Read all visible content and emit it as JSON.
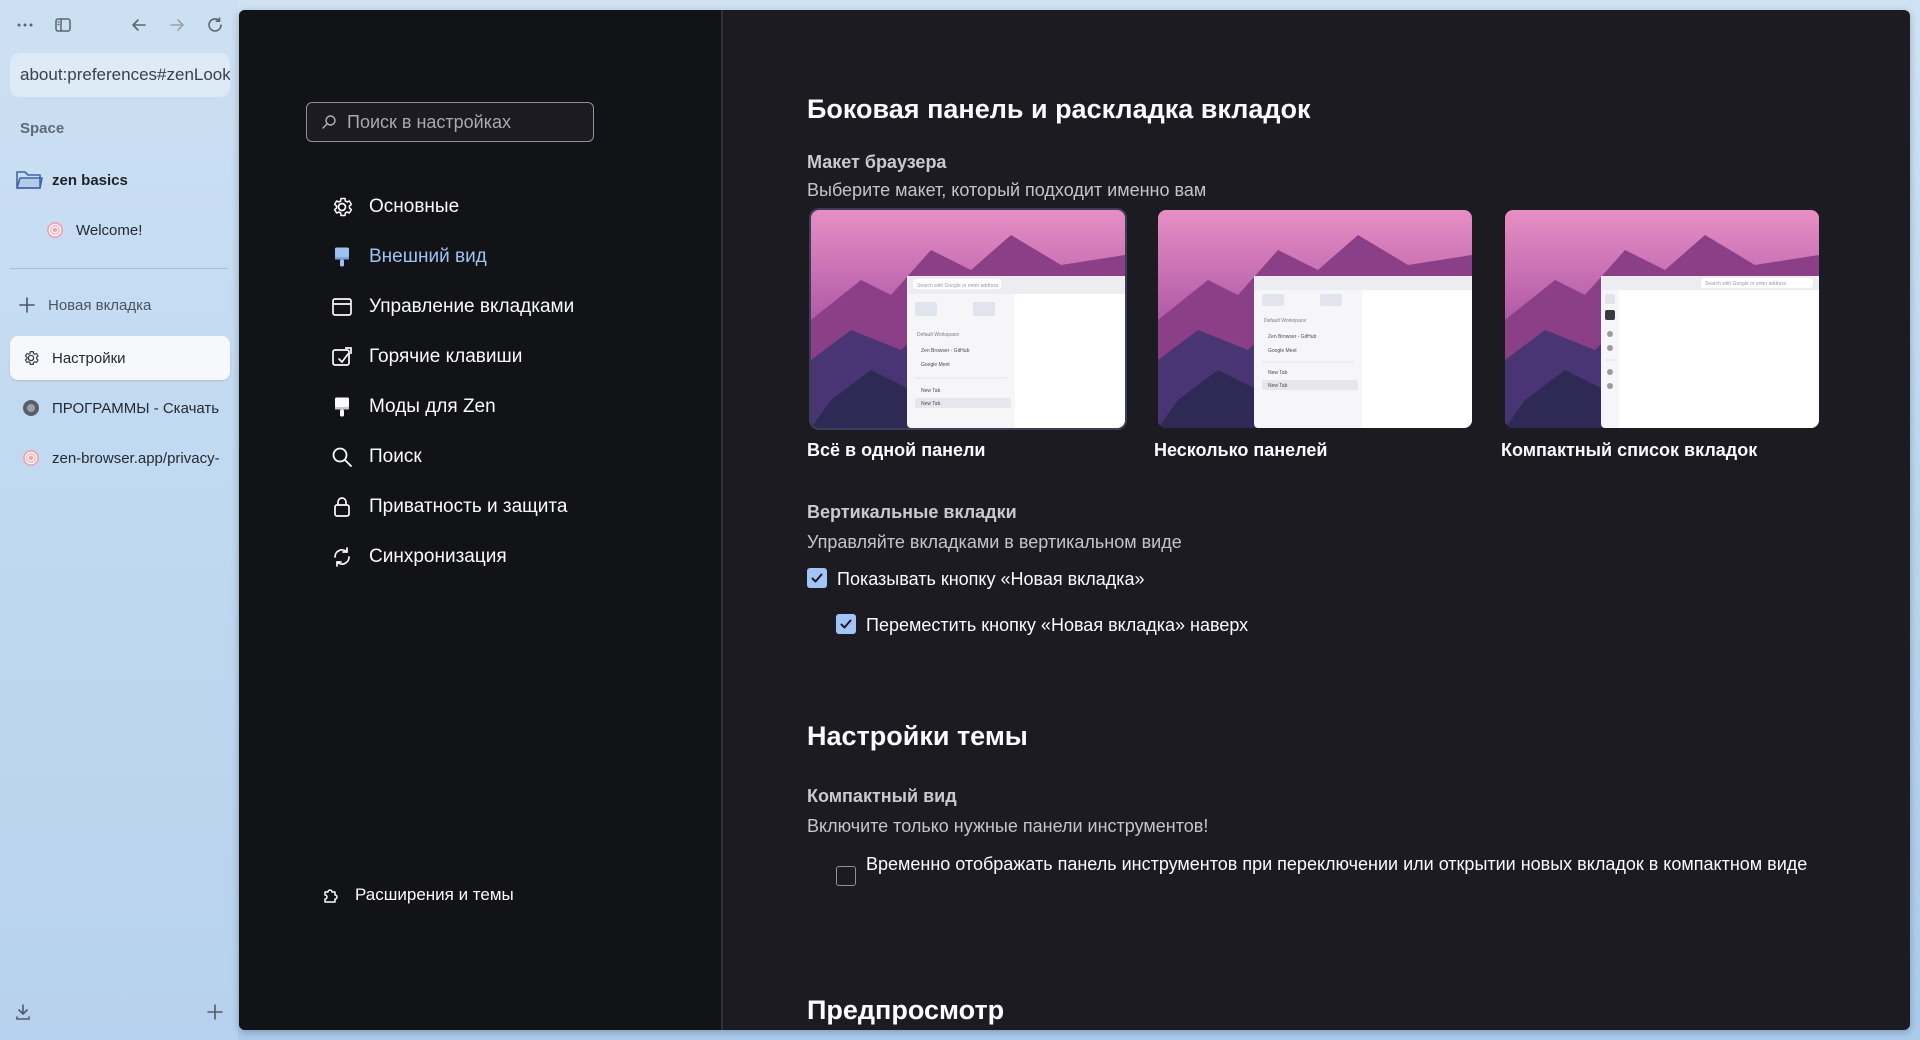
{
  "browser": {
    "url": "about:preferences#zenLooks",
    "space_label": "Space",
    "folder_name": "zen basics",
    "tabs": [
      {
        "label": "Welcome!"
      },
      {
        "label": "Настройки"
      },
      {
        "label": "ПРОГРАММЫ - Скачать"
      },
      {
        "label": "zen-browser.app/privacy-"
      }
    ],
    "new_tab_label": "Новая вкладка"
  },
  "nav": {
    "search_placeholder": "Поиск в настройках",
    "items": [
      {
        "label": "Основные",
        "icon": "gear-icon"
      },
      {
        "label": "Внешний вид",
        "icon": "paintbrush-icon"
      },
      {
        "label": "Управление вкладками",
        "icon": "window-icon"
      },
      {
        "label": "Горячие клавиши",
        "icon": "keyboard-shortcut-icon"
      },
      {
        "label": "Моды для Zen",
        "icon": "paintbrush-icon"
      },
      {
        "label": "Поиск",
        "icon": "search-icon"
      },
      {
        "label": "Приватность и защита",
        "icon": "lock-icon"
      },
      {
        "label": "Синхронизация",
        "icon": "sync-icon"
      }
    ],
    "extensions_label": "Расширения и темы"
  },
  "content": {
    "section1_title": "Боковая панель и раскладка вкладок",
    "layout_title": "Макет браузера",
    "layout_desc": "Выберите макет, который подходит именно вам",
    "layouts": [
      {
        "label": "Всё в одной панели",
        "selected": true
      },
      {
        "label": "Несколько панелей",
        "selected": false
      },
      {
        "label": "Компактный список вкладок",
        "selected": false
      }
    ],
    "vertical_title": "Вертикальные вкладки",
    "vertical_desc": "Управляйте вкладками в вертикальном виде",
    "show_newtab_label": "Показывать кнопку «Новая вкладка»",
    "move_newtab_label": "Переместить кнопку «Новая вкладка» наверх",
    "section2_title": "Настройки темы",
    "compact_title": "Компактный вид",
    "compact_desc": "Включите только нужные панели инструментов!",
    "compact_toggle_label": "Временно отображать панель инструментов при переключении или открытии новых вкладок в компактном виде",
    "section3_title": "Предпросмотр"
  },
  "preview_text": {
    "search": "Search with Google or enter address",
    "workspace": "Default Workspace",
    "github": "Zen Browser - GitHub",
    "meet": "Google Meet",
    "newtab": "New Tab"
  },
  "colors": {
    "accent": "#a2c5f6",
    "nav_selected": "#9fc1f0",
    "window_bg": "#1c1b22",
    "nav_bg": "#121317"
  }
}
